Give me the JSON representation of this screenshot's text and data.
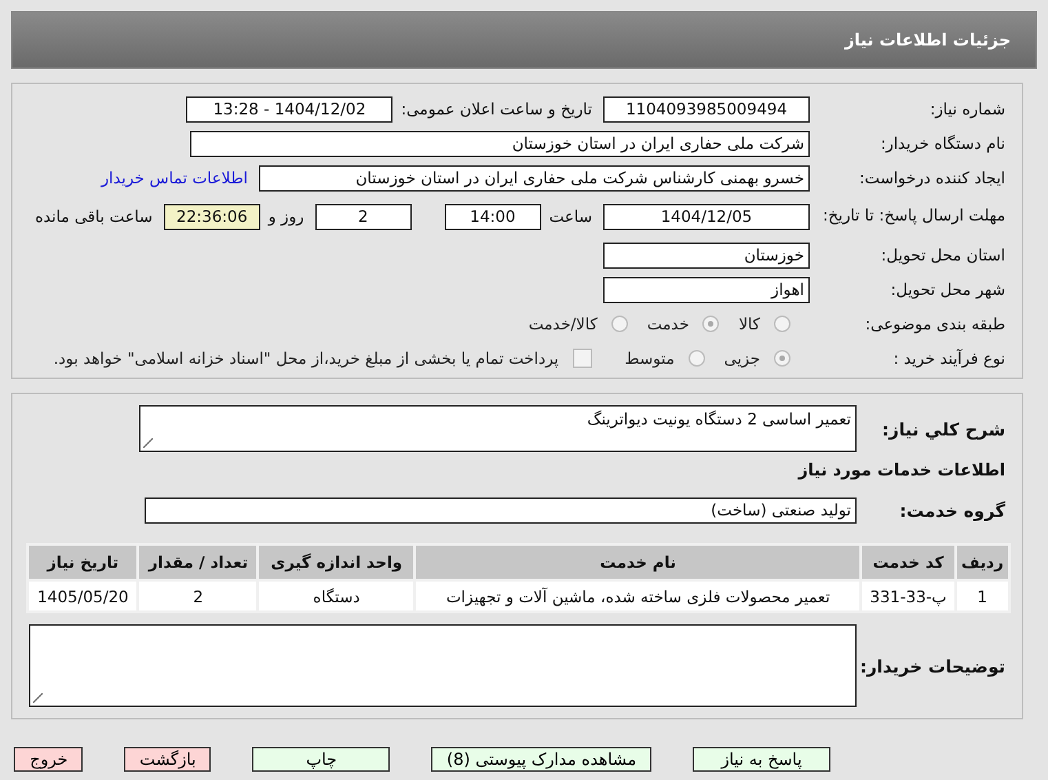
{
  "header": {
    "title": "جزئیات اطلاعات نیاز"
  },
  "need_number": {
    "label": "شماره نیاز:",
    "value": "1104093985009494"
  },
  "announce": {
    "label": "تاریخ و ساعت اعلان عمومی:",
    "value": "1404/12/02 - 13:28"
  },
  "buyer_org": {
    "label": "نام دستگاه خریدار:",
    "value": "شرکت ملی حفاری ایران در استان خوزستان"
  },
  "creator": {
    "label": "ایجاد کننده درخواست:",
    "value": "خسرو بهمنی کارشناس  شرکت ملی حفاری ایران در استان خوزستان",
    "link": "اطلاعات تماس خریدار"
  },
  "deadline": {
    "label": "مهلت ارسال پاسخ: تا تاریخ:",
    "date": "1404/12/05",
    "time_label": "ساعت",
    "time": "14:00",
    "days": "2",
    "days_label": "روز و",
    "remaining": "22:36:06",
    "remaining_label": "ساعت باقی مانده"
  },
  "province": {
    "label": "استان محل تحویل:",
    "value": "خوزستان"
  },
  "city": {
    "label": "شهر محل تحویل:",
    "value": "اهواز"
  },
  "category": {
    "label": "طبقه بندی موضوعی:",
    "options": [
      {
        "label": "کالا",
        "selected": false
      },
      {
        "label": "خدمت",
        "selected": true
      },
      {
        "label": "کالا/خدمت",
        "selected": false
      }
    ]
  },
  "purchase_type": {
    "label": "نوع فرآیند خرید :",
    "options": [
      {
        "label": "جزیی",
        "selected": true
      },
      {
        "label": "متوسط",
        "selected": false
      }
    ],
    "payment": {
      "label": "پرداخت تمام یا بخشی از مبلغ خرید،از محل \"اسناد خزانه اسلامی\" خواهد بود.",
      "checked": false
    }
  },
  "summary": {
    "label": "شرح کلي نياز:",
    "value": "تعمیر اساسی 2 دستگاه یونیت دیواترینگ"
  },
  "services_heading": "اطلاعات خدمات مورد نیاز",
  "service_group": {
    "label": "گروه خدمت:",
    "value": "تولید صنعتی (ساخت)"
  },
  "table": {
    "columns": [
      "ردیف",
      "کد خدمت",
      "نام خدمت",
      "واحد اندازه گیری",
      "تعداد / مقدار",
      "تاریخ نیاز"
    ],
    "rows": [
      [
        "1",
        "پ-33-331",
        "تعمیر محصولات فلزی ساخته شده، ماشین آلات و تجهیزات",
        "دستگاه",
        "2",
        "1405/05/20"
      ]
    ]
  },
  "buyer_notes": {
    "label": "توضیحات خریدار:"
  },
  "buttons": [
    {
      "label": "پاسخ به نیاز",
      "kind": "green"
    },
    {
      "label": "مشاهده مدارک پیوستی (8)",
      "kind": "green"
    },
    {
      "label": "چاپ",
      "kind": "green"
    },
    {
      "label": "بازگشت",
      "kind": "red"
    },
    {
      "label": "خروج",
      "kind": "red"
    }
  ]
}
